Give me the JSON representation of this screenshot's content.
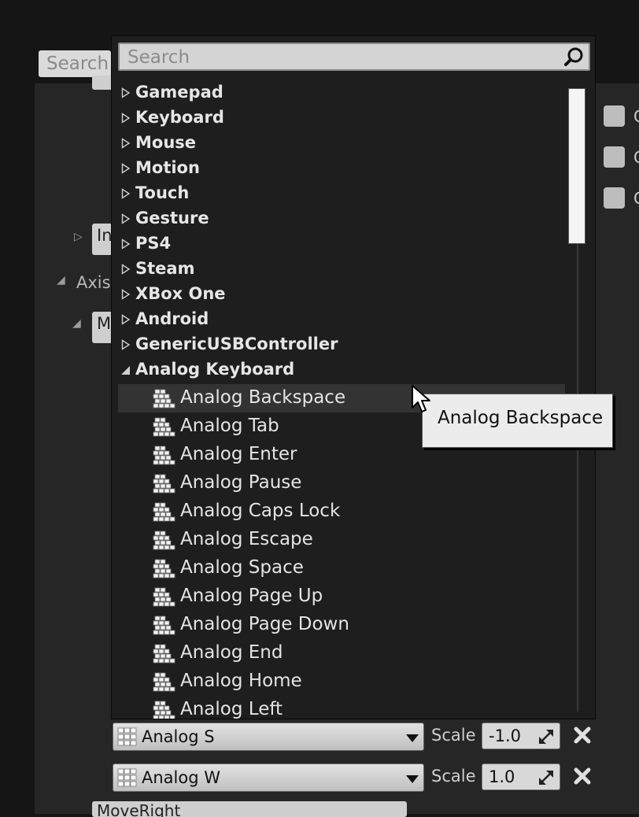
{
  "background": {
    "search_placeholder": "Search",
    "stub_in": "In",
    "axis_label": "Axis",
    "stub_m": "M",
    "checkbox_label": "C",
    "bottom_stub": "MoveRight"
  },
  "popup": {
    "search_placeholder": "Search",
    "categories": [
      {
        "label": "Gamepad",
        "expanded": false
      },
      {
        "label": "Keyboard",
        "expanded": false
      },
      {
        "label": "Mouse",
        "expanded": false
      },
      {
        "label": "Motion",
        "expanded": false
      },
      {
        "label": "Touch",
        "expanded": false
      },
      {
        "label": "Gesture",
        "expanded": false
      },
      {
        "label": "PS4",
        "expanded": false
      },
      {
        "label": "Steam",
        "expanded": false
      },
      {
        "label": "XBox One",
        "expanded": false
      },
      {
        "label": "Android",
        "expanded": false
      },
      {
        "label": "GenericUSBController",
        "expanded": false
      },
      {
        "label": "Analog Keyboard",
        "expanded": true
      }
    ],
    "keys": [
      "Analog Backspace",
      "Analog Tab",
      "Analog Enter",
      "Analog Pause",
      "Analog Caps Lock",
      "Analog Escape",
      "Analog Space",
      "Analog Page Up",
      "Analog Page Down",
      "Analog End",
      "Analog Home",
      "Analog Left"
    ],
    "highlighted_key": "Analog Backspace"
  },
  "tooltip": {
    "text": "Analog Backspace"
  },
  "mappings": [
    {
      "key": "Analog S",
      "scale_label": "Scale",
      "scale": "-1.0"
    },
    {
      "key": "Analog W",
      "scale_label": "Scale",
      "scale": "1.0"
    }
  ],
  "colors": {
    "popup_bg": "#1e1e1e",
    "highlight": "#333333",
    "search_bg": "#d4d4d4"
  }
}
